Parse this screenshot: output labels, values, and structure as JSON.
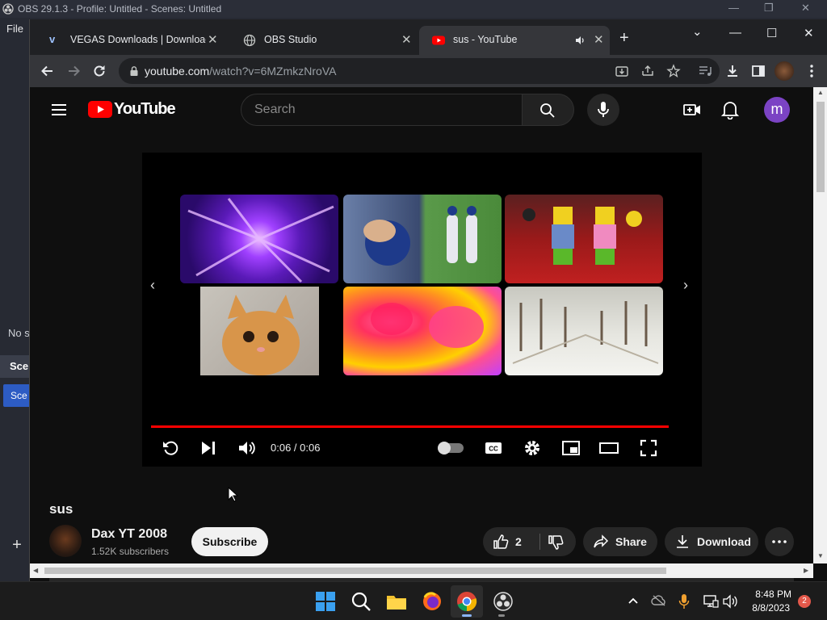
{
  "obs": {
    "title": "OBS 29.1.3 - Profile: Untitled - Scenes: Untitled",
    "menu_file": "File",
    "no_source": "No s",
    "scenes_header": "Sce",
    "scene_item": "Sce"
  },
  "chrome": {
    "tabs": [
      {
        "label": "VEGAS Downloads | Download i",
        "favicon": "vegas-v"
      },
      {
        "label": "OBS Studio",
        "favicon": "globe-icon"
      },
      {
        "label": "sus - YouTube",
        "favicon": "youtube-icon",
        "active": true,
        "audio": true
      }
    ],
    "url_host": "youtube.com",
    "url_path": "/watch?v=6MZmkzNroVA"
  },
  "youtube": {
    "logo_text": "YouTube",
    "search_placeholder": "Search",
    "account_initial": "m",
    "player": {
      "time_text": "0:06 / 0:06",
      "progress": 1.0
    },
    "video_title": "sus",
    "channel_name": "Dax YT 2008",
    "subscribers": "1.52K subscribers",
    "subscribe_label": "Subscribe",
    "like_count": "2",
    "share_label": "Share",
    "download_label": "Download"
  },
  "taskbar": {
    "time": "8:48 PM",
    "date": "8/8/2023",
    "notifications": "2"
  },
  "colors": {
    "yt_red": "#ff0000",
    "accent_blue": "#2d5cc4",
    "avatar_purple": "#7b43c4"
  }
}
